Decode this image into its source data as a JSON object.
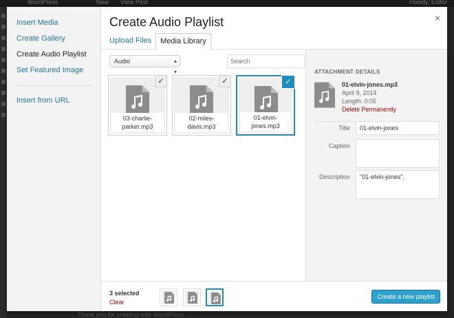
{
  "backdrop": {
    "admin_bar_site": "WordPress",
    "admin_bar_new": "New",
    "admin_bar_view": "View Post",
    "admin_bar_user": "Howdy, Editor",
    "footer": "Thank you for creating with WordPress"
  },
  "menu": {
    "items": [
      {
        "label": "Insert Media"
      },
      {
        "label": "Create Gallery"
      },
      {
        "label": "Create Audio Playlist"
      },
      {
        "label": "Set Featured Image"
      }
    ],
    "insert_url": "Insert from URL"
  },
  "title": "Create Audio Playlist",
  "close": "×",
  "tabs": [
    "Upload Files",
    "Media Library"
  ],
  "toolbar": {
    "filter_selected": "Audio",
    "search_placeholder": "Search"
  },
  "attachments": [
    {
      "filename_line1": "03-charlie-",
      "filename_line2": "parker.mp3",
      "selected": false
    },
    {
      "filename_line1": "02-miles-",
      "filename_line2": "davis.mp3",
      "selected": false
    },
    {
      "filename_line1": "01-elvin-",
      "filename_line2": "jones.mp3",
      "selected": true
    }
  ],
  "check_glyph": "✓",
  "details": {
    "heading": "ATTACHMENT DETAILS",
    "filename": "01-elvin-jones.mp3",
    "date": "April 9, 2014",
    "length": "Length: 0:05",
    "delete": "Delete Permanently",
    "title_label": "Title",
    "title_value": "01-elvin-jones",
    "caption_label": "Caption",
    "caption_value": "",
    "description_label": "Description",
    "description_value": "\"01-elvin-jones\"."
  },
  "bottom": {
    "selected_count": "3 selected",
    "clear": "Clear",
    "create_button": "Create a new playlist"
  },
  "colors": {
    "accent": "#1e8cbe",
    "button": "#2ea2cc",
    "delete": "#aa0000",
    "link": "#21759b"
  }
}
